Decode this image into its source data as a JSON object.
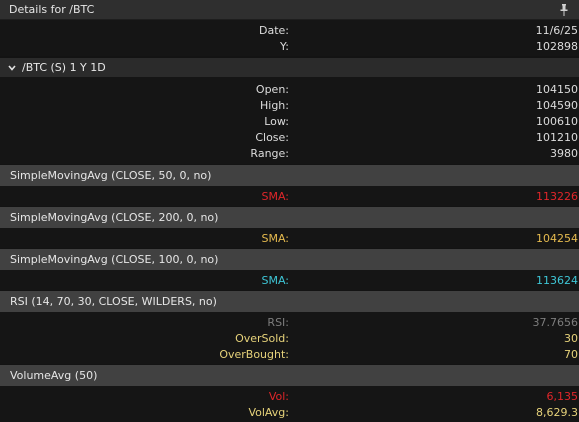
{
  "title": "Details for /BTC",
  "top_rows": [
    {
      "label": "Date:",
      "value": "11/6/25"
    },
    {
      "label": "Y:",
      "value": "102898"
    }
  ],
  "symbol_group": {
    "label": "/BTC (S) 1 Y 1D",
    "rows": [
      {
        "label": "Open:",
        "value": "104150"
      },
      {
        "label": "High:",
        "value": "104590"
      },
      {
        "label": "Low:",
        "value": "100610"
      },
      {
        "label": "Close:",
        "value": "101210"
      },
      {
        "label": "Range:",
        "value": "3980"
      }
    ]
  },
  "studies": [
    {
      "header": "SimpleMovingAvg (CLOSE, 50, 0, no)",
      "rows": [
        {
          "label": "SMA:",
          "value": "113226",
          "color": "#e0262a"
        }
      ]
    },
    {
      "header": "SimpleMovingAvg (CLOSE, 200, 0, no)",
      "rows": [
        {
          "label": "SMA:",
          "value": "104254",
          "color": "#e6bb4f"
        }
      ]
    },
    {
      "header": "SimpleMovingAvg (CLOSE, 100, 0, no)",
      "rows": [
        {
          "label": "SMA:",
          "value": "113624",
          "color": "#3ec6d6"
        }
      ]
    },
    {
      "header": "RSI (14, 70, 30, CLOSE, WILDERS, no)",
      "rows": [
        {
          "label": "RSI:",
          "value": "37.7656",
          "color": "#7d7d7d"
        },
        {
          "label": "OverSold:",
          "value": "30",
          "color": "#e6d27a"
        },
        {
          "label": "OverBought:",
          "value": "70",
          "color": "#e6d27a"
        }
      ]
    },
    {
      "header": "VolumeAvg (50)",
      "rows": [
        {
          "label": "Vol:",
          "value": "6,135",
          "color": "#e0262a"
        },
        {
          "label": "VolAvg:",
          "value": "8,629.3",
          "color": "#e6d27a"
        }
      ]
    }
  ],
  "icons": {
    "pin": "pin-icon",
    "chevron": "chevron-down-icon"
  }
}
